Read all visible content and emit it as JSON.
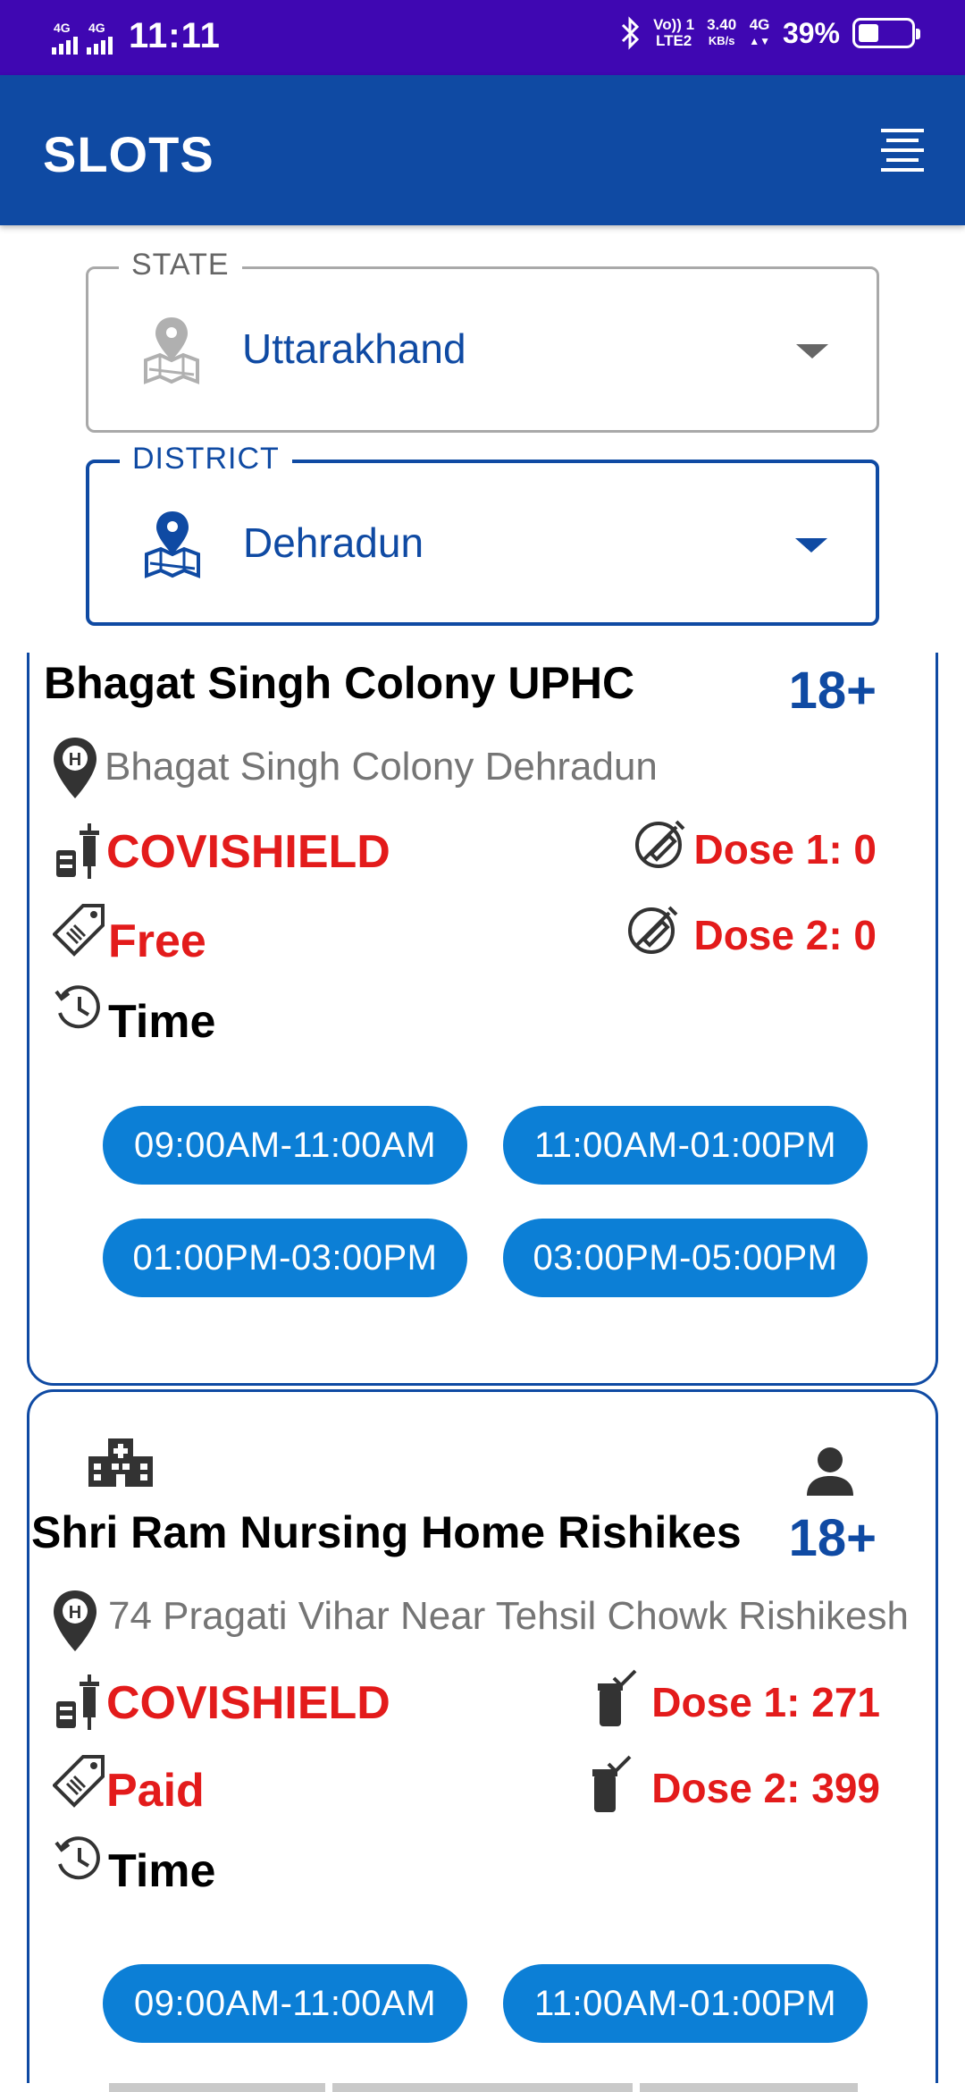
{
  "status_bar": {
    "sim1": "4G",
    "sim2": "4G",
    "time": "11:11",
    "volte": "Vo)) 1",
    "lte": "LTE2",
    "speed": "3.40",
    "speed_unit": "KB/s",
    "net": "4G",
    "battery": "39%",
    "battery_level": 0.39
  },
  "app_bar": {
    "title": "SLOTS"
  },
  "filters": {
    "state": {
      "label": "STATE",
      "value": "Uttarakhand"
    },
    "district": {
      "label": "DISTRICT",
      "value": "Dehradun"
    }
  },
  "centers": [
    {
      "name": "Bhagat Singh Colony UPHC",
      "age": "18+",
      "address": "Bhagat Singh Colony Dehradun",
      "vaccine": "COVISHIELD",
      "fee": "Free",
      "dose1": "Dose 1: 0",
      "dose2": "Dose 2: 0",
      "time_label": "Time",
      "slots": [
        "09:00AM-11:00AM",
        "11:00AM-01:00PM",
        "01:00PM-03:00PM",
        "03:00PM-05:00PM"
      ]
    },
    {
      "name": "Shri Ram Nursing Home Rishikes",
      "age": "18+",
      "address": "74 Pragati Vihar Near Tehsil Chowk Rishikesh",
      "vaccine": "COVISHIELD",
      "fee": "Paid",
      "dose1": "Dose 1: 271",
      "dose2": "Dose 2: 399",
      "time_label": "Time",
      "slots": [
        "09:00AM-11:00AM",
        "11:00AM-01:00PM"
      ]
    }
  ],
  "colors": {
    "status_bar": "#3f07b2",
    "app_bar": "#0f4aa3",
    "slot": "#0c7fd6",
    "alert": "#e31b1b"
  }
}
